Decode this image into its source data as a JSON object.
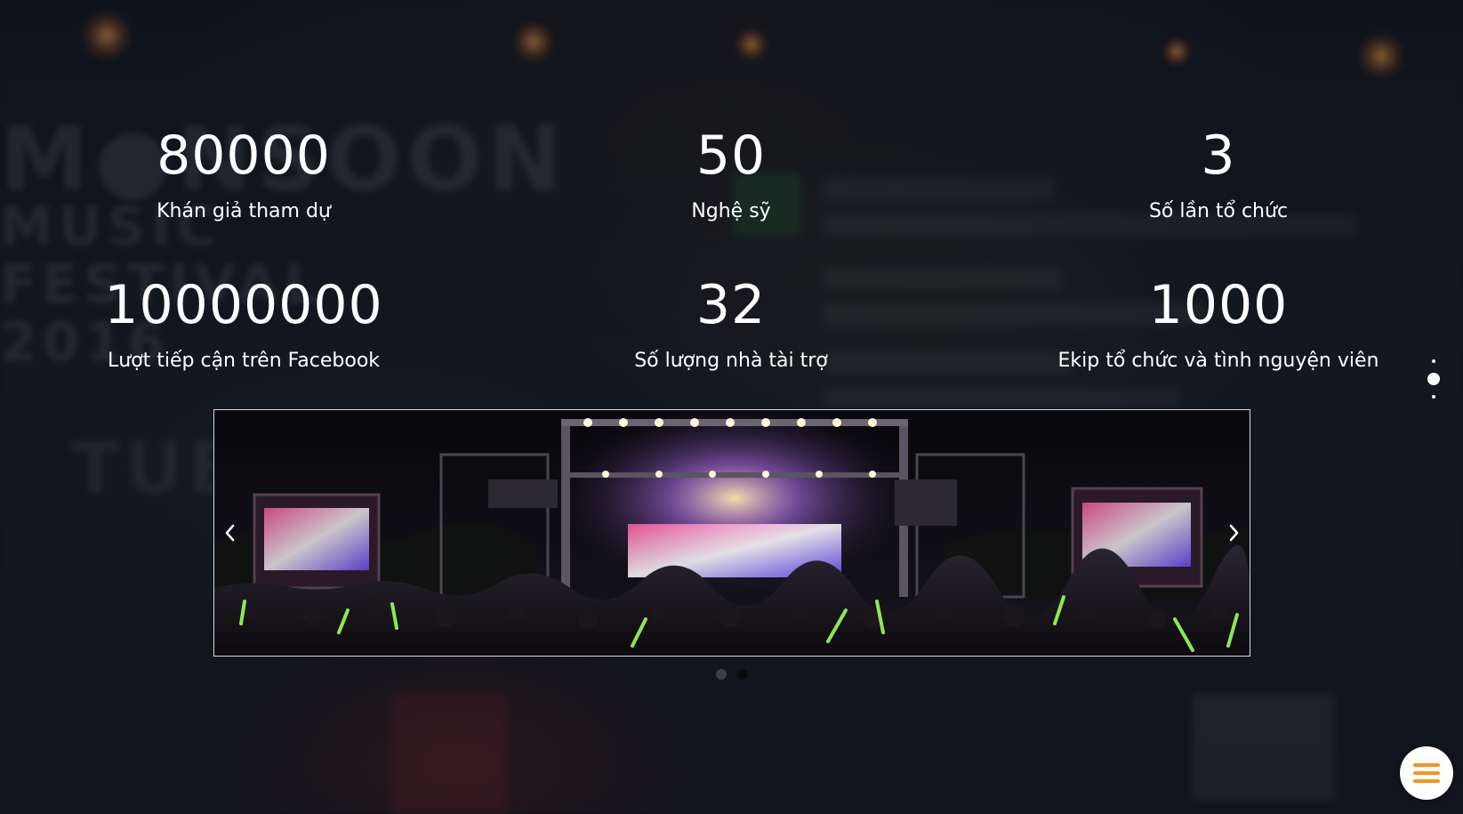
{
  "stats": [
    {
      "value": "80000",
      "label": "Khán giả tham dự"
    },
    {
      "value": "50",
      "label": "Nghệ sỹ"
    },
    {
      "value": "3",
      "label": "Số lần tổ chức"
    },
    {
      "value": "10000000",
      "label": "Lượt tiếp cận trên Facebook"
    },
    {
      "value": "32",
      "label": "Số lượng nhà tài trợ"
    },
    {
      "value": "1000",
      "label": "Ekip tổ chức và tình nguyện viên"
    }
  ],
  "carousel": {
    "slide_count": 2,
    "active_slide": 2,
    "prev_icon": "chevron-left-icon",
    "next_icon": "chevron-right-icon",
    "border_color": "#d9d9d9"
  },
  "section_nav": {
    "count": 3,
    "active_index": 1
  },
  "menu_button": {
    "icon": "hamburger-menu-icon",
    "icon_color": "#f7931e",
    "background": "#ffffff"
  },
  "colors": {
    "text": "#ffffff",
    "accent": "#f7931e"
  }
}
